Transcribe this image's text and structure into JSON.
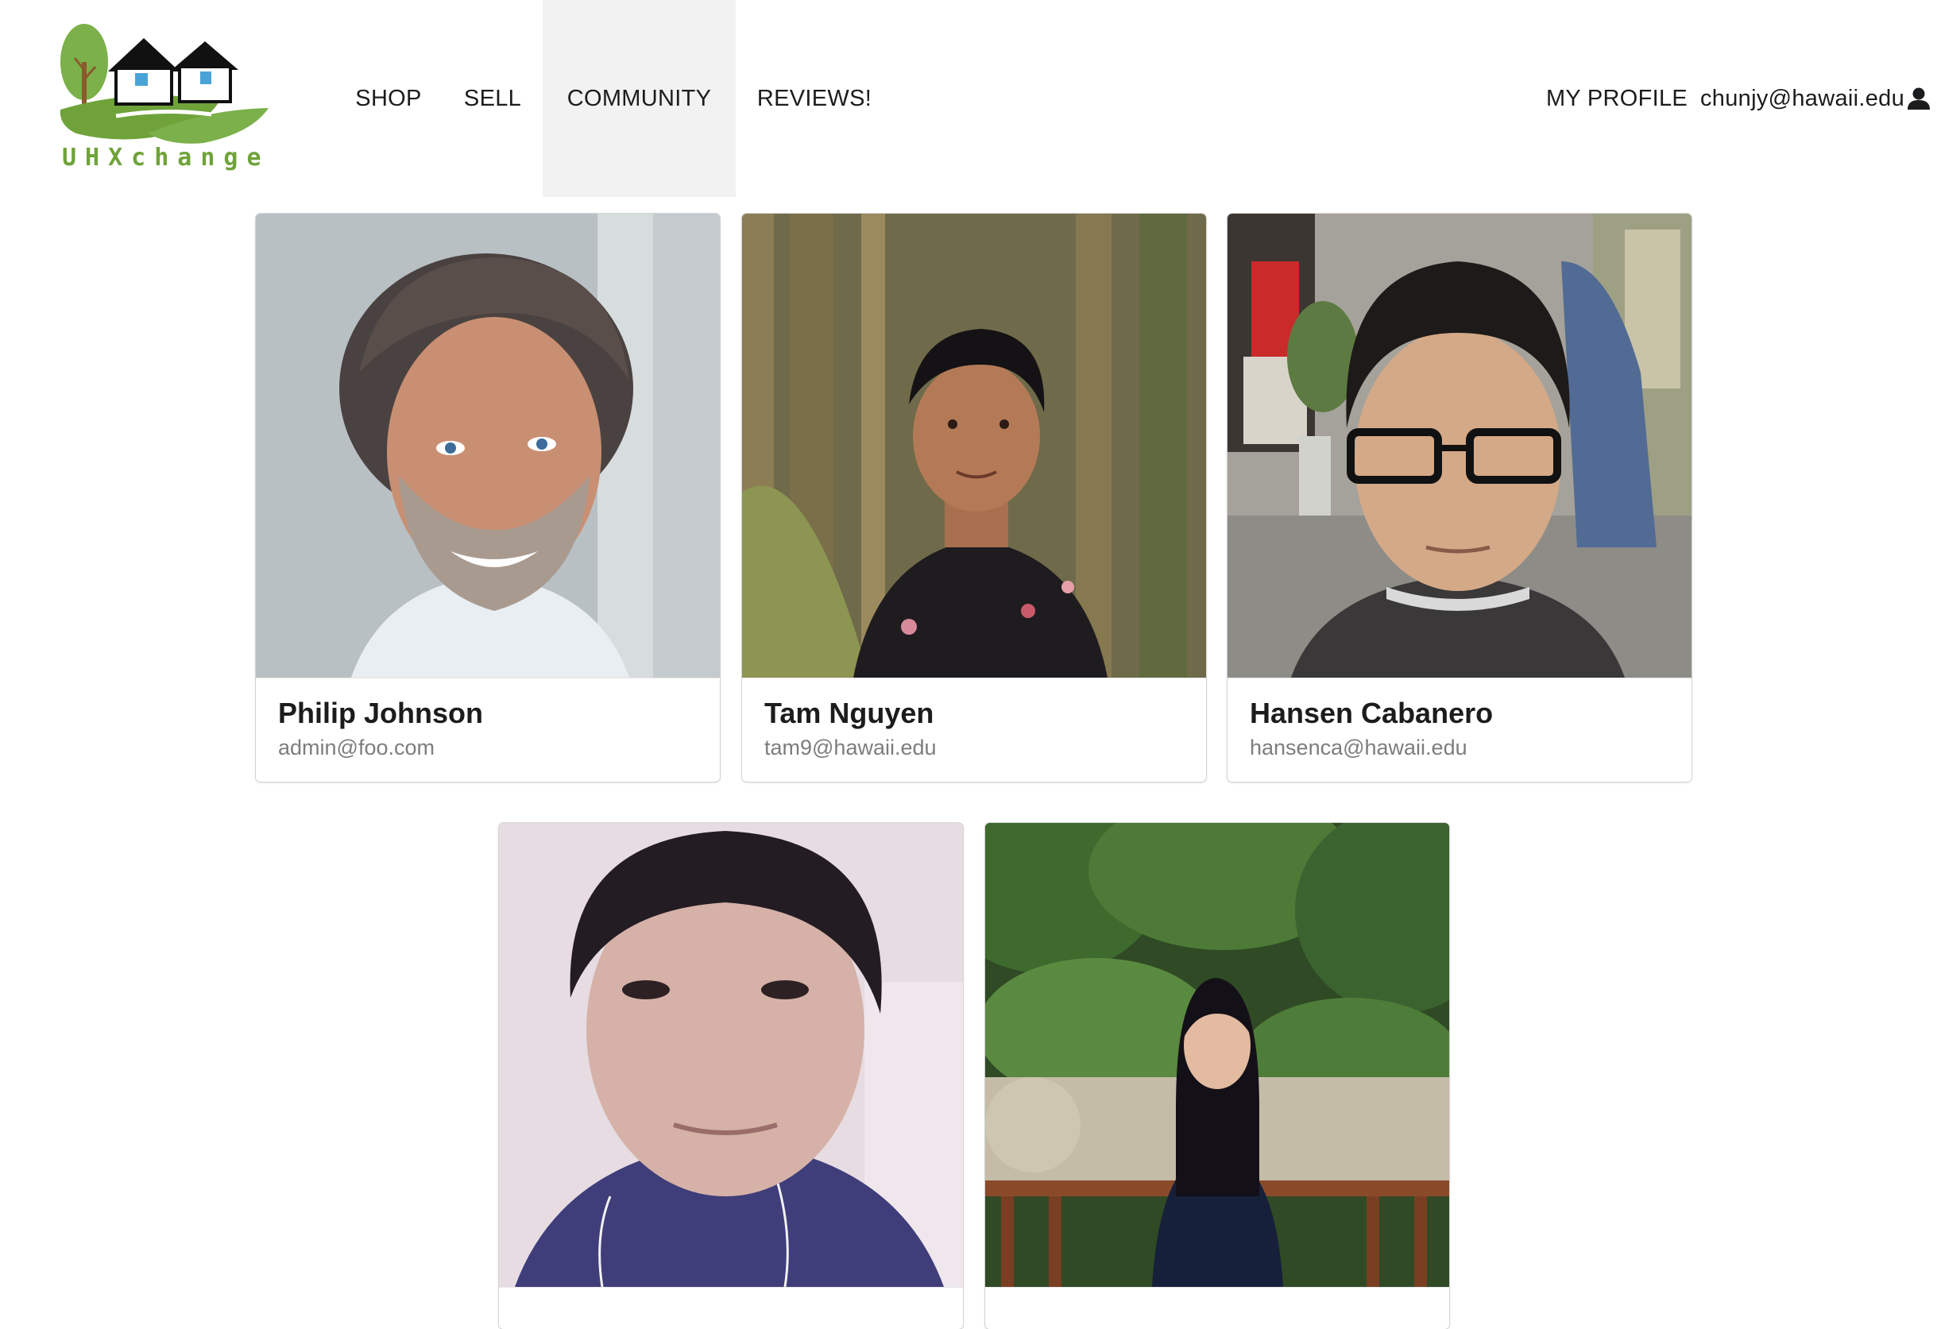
{
  "logo": {
    "text": "UHXchange"
  },
  "nav": {
    "items": [
      {
        "label": "SHOP"
      },
      {
        "label": "SELL"
      },
      {
        "label": "COMMUNITY",
        "active": true
      },
      {
        "label": "REVIEWS!"
      }
    ],
    "profile_label": "MY PROFILE",
    "user_email": "chunjy@hawaii.edu",
    "user_icon": "user-icon"
  },
  "profiles": [
    {
      "name": "Philip Johnson",
      "email": "admin@foo.com"
    },
    {
      "name": "Tam Nguyen",
      "email": "tam9@hawaii.edu"
    },
    {
      "name": "Hansen Cabanero",
      "email": "hansenca@hawaii.edu"
    },
    {
      "name": "",
      "email": ""
    },
    {
      "name": "",
      "email": ""
    }
  ],
  "colors": {
    "active_nav_bg": "#f2f2f2",
    "logo_green": "#7bb04a",
    "logo_text": "#6fa33a"
  }
}
